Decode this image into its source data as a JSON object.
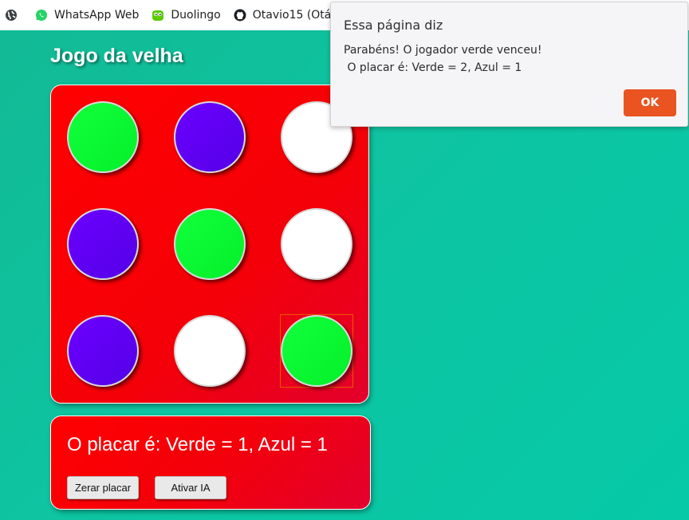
{
  "bookmarks": [
    {
      "label": "",
      "icon": "globe-icon"
    },
    {
      "label": "WhatsApp Web",
      "icon": "whatsapp-icon"
    },
    {
      "label": "Duolingo",
      "icon": "duolingo-icon"
    },
    {
      "label": "Otavio15 (Otá...",
      "icon": "github-icon"
    }
  ],
  "game": {
    "title": "Jogo da velha",
    "board": [
      [
        "green",
        "blue",
        "empty"
      ],
      [
        "blue",
        "green",
        "empty"
      ],
      [
        "blue",
        "empty",
        "green"
      ]
    ],
    "highlighted_cell": "row 3, column 3"
  },
  "score": {
    "text": "O placar é: Verde = 1, Azul = 1",
    "reset_label": "Zerar placar",
    "ai_label": "Ativar IA"
  },
  "dialog": {
    "title": "Essa página diz",
    "message_line1": "Parabéns! O jogador verde venceu!",
    "message_line2": " O placar é: Verde = 2, Azul = 1",
    "ok_label": "OK"
  },
  "colors": {
    "background": "#0ec4a1",
    "board": "#ff0000",
    "green_piece": "#0af530",
    "blue_piece": "#6000f5",
    "ok_button": "#e95420"
  }
}
